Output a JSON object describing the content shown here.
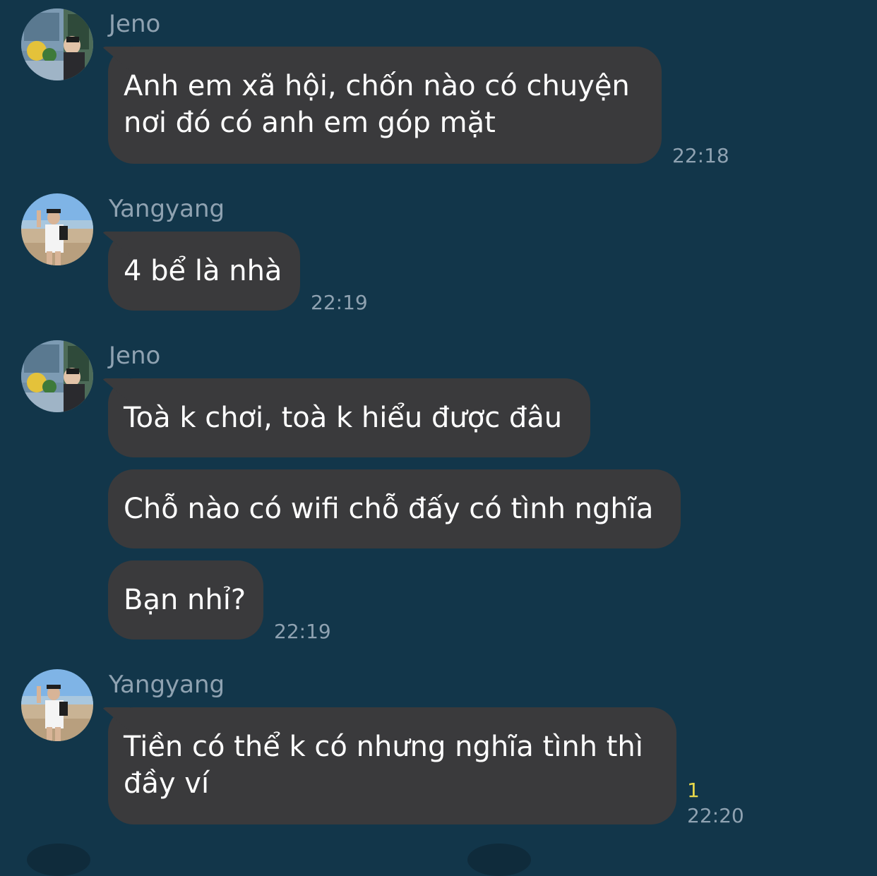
{
  "messages": [
    {
      "sender": "Jeno",
      "avatar": "jeno-avatar",
      "bubbles": [
        {
          "lines": [
            "Anh em xã hội, chốn nào có chuyện",
            "nơi đó có anh em góp mặt"
          ]
        }
      ],
      "time": "22:18"
    },
    {
      "sender": "Yangyang",
      "avatar": "yangyang-avatar",
      "bubbles": [
        {
          "lines": [
            "4 bể là nhà"
          ]
        }
      ],
      "time": "22:19"
    },
    {
      "sender": "Jeno",
      "avatar": "jeno-avatar",
      "bubbles": [
        {
          "lines": [
            "Toà k chơi, toà k hiểu được đâu"
          ]
        },
        {
          "lines": [
            "Chỗ nào có wifi chỗ đấy có tình nghĩa"
          ]
        },
        {
          "lines": [
            "Bạn nhỉ?"
          ]
        }
      ],
      "time": "22:19"
    },
    {
      "sender": "Yangyang",
      "avatar": "yangyang-avatar",
      "bubbles": [
        {
          "lines": [
            "Tiền có thể k có nhưng nghĩa tình thì",
            "đầy ví"
          ]
        }
      ],
      "time": "22:20",
      "read_count": "1"
    }
  ],
  "colors": {
    "background": "#12364a",
    "bubble": "#3a3a3c",
    "meta_text": "#8fa2b1",
    "read_count": "#e8d84a"
  }
}
